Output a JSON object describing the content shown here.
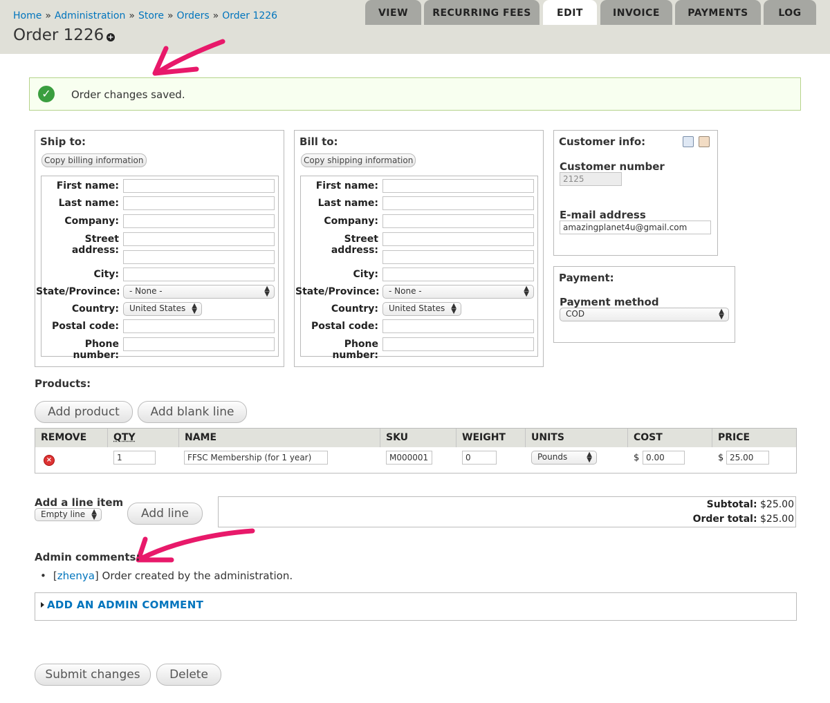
{
  "breadcrumb": [
    {
      "label": "Home"
    },
    {
      "label": "Administration"
    },
    {
      "label": "Store"
    },
    {
      "label": "Orders"
    },
    {
      "label": "Order 1226"
    }
  ],
  "breadcrumb_sep": "»",
  "page_title": "Order 1226",
  "tabs": [
    {
      "label": "VIEW"
    },
    {
      "label": "RECURRING FEES"
    },
    {
      "label": "EDIT"
    },
    {
      "label": "INVOICE"
    },
    {
      "label": "PAYMENTS"
    },
    {
      "label": "LOG"
    }
  ],
  "message": "Order changes saved.",
  "ship": {
    "title": "Ship to:",
    "copy_button": "Copy billing information"
  },
  "bill": {
    "title": "Bill to:",
    "copy_button": "Copy shipping information"
  },
  "address_labels": {
    "first_name": "First name:",
    "last_name": "Last name:",
    "company": "Company:",
    "street": "Street address:",
    "city": "City:",
    "state": "State/Province:",
    "country": "Country:",
    "postal": "Postal code:",
    "phone": "Phone number:"
  },
  "state_value": "- None -",
  "country_value": "United States",
  "customer": {
    "title": "Customer info:",
    "number_label": "Customer number",
    "number_value": "2125",
    "email_label": "E-mail address",
    "email_value": "amazingplanet4u@gmail.com"
  },
  "payment": {
    "title": "Payment:",
    "method_label": "Payment method",
    "method_value": "COD"
  },
  "products": {
    "title": "Products:",
    "add_product": "Add product",
    "add_blank": "Add blank line",
    "headers": [
      "REMOVE",
      "QTY",
      "NAME",
      "SKU",
      "WEIGHT",
      "UNITS",
      "COST",
      "PRICE"
    ],
    "row": {
      "qty": "1",
      "name": "FFSC Membership (for 1 year)",
      "sku": "M000001",
      "weight": "0",
      "units": "Pounds",
      "currency": "$",
      "cost": "0.00",
      "price": "25.00"
    }
  },
  "line_item": {
    "title": "Add a line item",
    "select_value": "Empty line",
    "add_button": "Add line"
  },
  "totals": {
    "subtotal_label": "Subtotal:",
    "subtotal_value": "$25.00",
    "order_total_label": "Order total:",
    "order_total_value": "$25.00"
  },
  "admin": {
    "title": "Admin comments:",
    "comment_open": "[",
    "comment_user": "zhenya",
    "comment_close": "]",
    "comment_text": " Order created by the administration.",
    "add_comment": "ADD AN ADMIN COMMENT"
  },
  "actions": {
    "submit": "Submit changes",
    "delete": "Delete"
  },
  "colors": {
    "link": "#0074bd",
    "success_bg": "#f8fff0",
    "success_border": "#b5d38b",
    "annotation_arrow": "#e8196a"
  }
}
